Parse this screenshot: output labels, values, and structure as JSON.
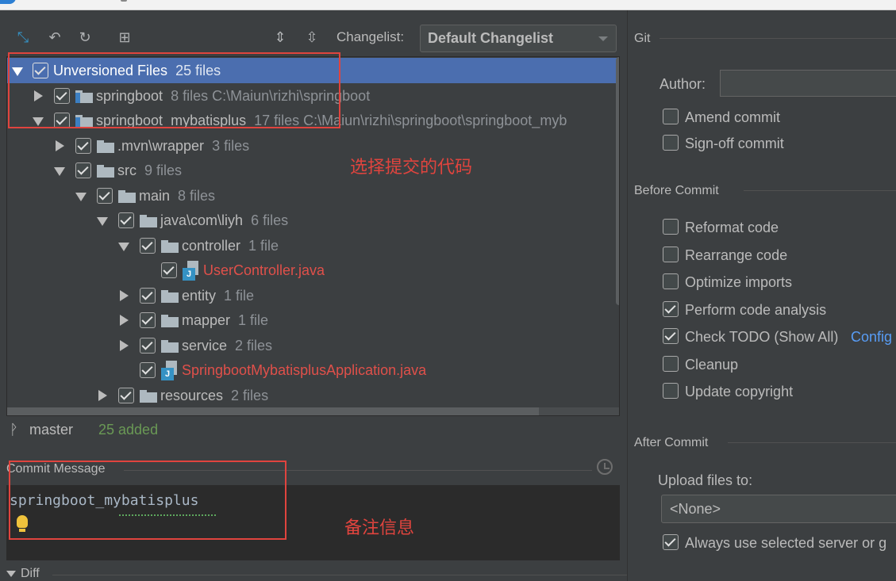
{
  "toolbar": {
    "changelist_label": "Changelist:",
    "changelist_value": "Default Changelist"
  },
  "tree": {
    "rows": [
      {
        "name": "Unversioned Files",
        "meta": "25 files"
      },
      {
        "name": "springboot",
        "meta": "8 files  C:\\Maiun\\rizhi\\springboot"
      },
      {
        "name": "springboot_mybatisplus",
        "meta": "17 files  C:\\Maiun\\rizhi\\springboot\\springboot_myb"
      },
      {
        "name": ".mvn\\wrapper",
        "meta": "3 files"
      },
      {
        "name": "src",
        "meta": "9 files"
      },
      {
        "name": "main",
        "meta": "8 files"
      },
      {
        "name": "java\\com\\liyh",
        "meta": "6 files"
      },
      {
        "name": "controller",
        "meta": "1 file"
      },
      {
        "name": "UserController.java",
        "meta": ""
      },
      {
        "name": "entity",
        "meta": "1 file"
      },
      {
        "name": "mapper",
        "meta": "1 file"
      },
      {
        "name": "service",
        "meta": "2 files"
      },
      {
        "name": "SpringbootMybatisplusApplication.java",
        "meta": ""
      },
      {
        "name": "resources",
        "meta": "2 files"
      }
    ]
  },
  "status": {
    "branch": "master",
    "added": "25 added"
  },
  "annotations": {
    "select_code": "选择提交的代码",
    "remark_info": "备注信息"
  },
  "commit": {
    "label": "Commit Message",
    "message": "springboot_mybatisplus"
  },
  "diff_label": "Diff",
  "right_panel": {
    "git_title": "Git",
    "author_label": "Author:",
    "author_value": "",
    "amend_commit": "Amend commit",
    "signoff_commit": "Sign-off commit",
    "before_commit_title": "Before Commit",
    "reformat_code": "Reformat code",
    "rearrange_code": "Rearrange code",
    "optimize_imports": "Optimize imports",
    "perform_analysis": "Perform code analysis",
    "check_todo": "Check TODO (Show All)",
    "configure_link": "Config",
    "cleanup": "Cleanup",
    "update_copyright": "Update copyright",
    "after_commit_title": "After Commit",
    "upload_label": "Upload files to:",
    "upload_value": "<None>",
    "always_use": "Always use selected server or g"
  },
  "colors": {
    "selection": "#4b6eaf",
    "annotation_red": "#e0443e",
    "unversioned_red": "#e0504a",
    "added_green": "#6a9955",
    "link_blue": "#589df6"
  }
}
